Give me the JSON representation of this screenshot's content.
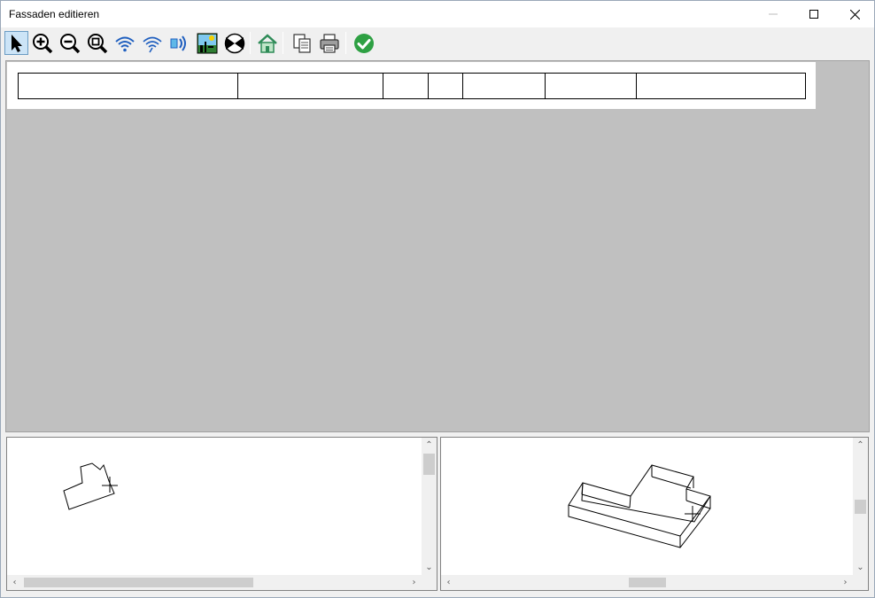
{
  "window": {
    "title": "Fassaden editieren"
  },
  "toolbar": {
    "buttons": [
      {
        "icon": "pointer-arrow-icon",
        "active": true
      },
      {
        "icon": "zoom-in-icon"
      },
      {
        "icon": "zoom-out-icon"
      },
      {
        "icon": "zoom-extents-icon"
      },
      {
        "icon": "signal-wave-icon"
      },
      {
        "icon": "signal-wave-alt-icon"
      },
      {
        "icon": "sound-wave-icon"
      },
      {
        "icon": "landscape-image-icon"
      },
      {
        "icon": "bowtie-shading-icon"
      },
      {
        "icon": "house-icon"
      },
      {
        "icon": "copy-document-icon"
      },
      {
        "icon": "printer-icon"
      },
      {
        "icon": "confirm-check-icon"
      }
    ]
  },
  "colors": {
    "workspace_bg": "#c0c0c0",
    "confirm_green": "#2ea043",
    "house_green": "#2e8b57",
    "icon_blue": "#1f5fbf"
  },
  "facade_table": {
    "cells": [
      "",
      "",
      "",
      "",
      "",
      "",
      ""
    ]
  }
}
